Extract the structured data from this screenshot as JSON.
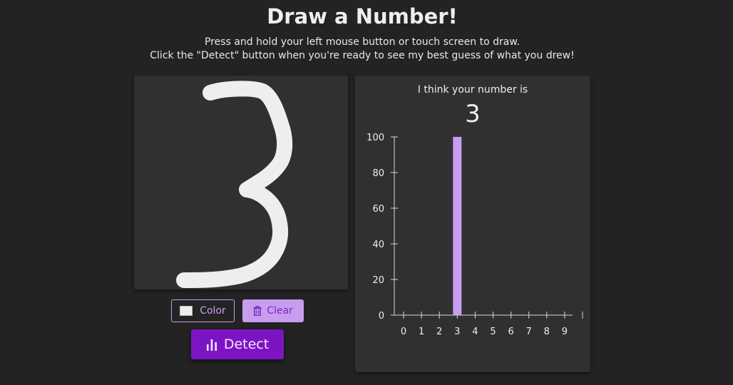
{
  "header": {
    "title": "Draw a Number!",
    "instruction_line1": "Press and hold your left mouse button or touch screen to draw.",
    "instruction_line2": "Click the \"Detect\" button when you're ready to see my best guess of what you drew!"
  },
  "controls": {
    "color_label": "Color",
    "clear_label": "Clear",
    "detect_label": "Detect",
    "pen_color": "#eeeeee"
  },
  "result": {
    "heading": "I think your number is",
    "prediction": "3"
  },
  "colors": {
    "accent": "#c79df0",
    "detect": "#7d14c4",
    "bar": "#c79df0"
  },
  "chart_data": {
    "type": "bar",
    "categories": [
      "0",
      "1",
      "2",
      "3",
      "4",
      "5",
      "6",
      "7",
      "8",
      "9"
    ],
    "values": [
      0,
      0,
      0,
      100,
      0,
      0,
      0,
      0,
      0,
      0
    ],
    "ylim": [
      0,
      100
    ],
    "yticks": [
      0,
      20,
      40,
      60,
      80,
      100
    ],
    "grid": false
  }
}
